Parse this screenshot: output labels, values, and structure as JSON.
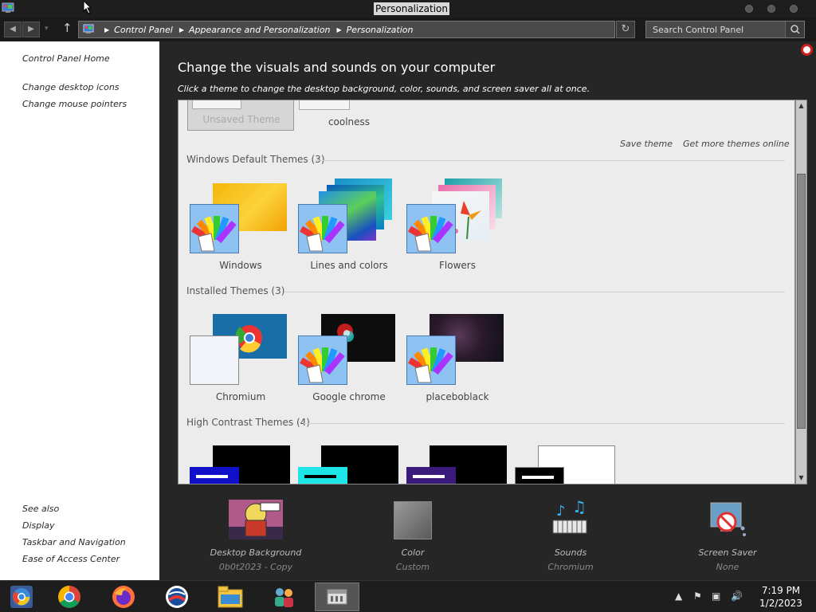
{
  "window": {
    "title": "Personalization"
  },
  "nav": {
    "breadcrumbs": [
      "Control Panel",
      "Appearance and Personalization",
      "Personalization"
    ],
    "search_placeholder": "Search Control Panel"
  },
  "sidebar": {
    "home": "Control Panel Home",
    "links": [
      "Change desktop icons",
      "Change mouse pointers"
    ],
    "see_also_title": "See also",
    "see_also": [
      "Display",
      "Taskbar and Navigation",
      "Ease of Access Center"
    ]
  },
  "main": {
    "heading": "Change the visuals and sounds on your computer",
    "subheading": "Click a theme to change the desktop background, color, sounds, and screen saver all at once.",
    "my_themes": [
      "Unsaved Theme",
      "coolness"
    ],
    "actions": {
      "save": "Save theme",
      "more": "Get more themes online"
    },
    "sections": {
      "default": {
        "title": "Windows Default Themes (3)",
        "themes": [
          "Windows",
          "Lines and colors",
          "Flowers"
        ]
      },
      "installed": {
        "title": "Installed Themes (3)",
        "themes": [
          "Chromium",
          "Google chrome",
          "placeboblack"
        ]
      },
      "contrast": {
        "title": "High Contrast Themes (4)"
      }
    }
  },
  "options": [
    {
      "label": "Desktop Background",
      "value": "0b0t2023 - Copy",
      "icon": "desktop-background-icon"
    },
    {
      "label": "Color",
      "value": "Custom",
      "icon": "color-swatch-icon"
    },
    {
      "label": "Sounds",
      "value": "Chromium",
      "icon": "sounds-icon"
    },
    {
      "label": "Screen Saver",
      "value": "None",
      "icon": "screen-saver-icon"
    }
  ],
  "taskbar": {
    "apps": [
      "chromium-icon",
      "chrome-icon",
      "firefox-icon",
      "obs-icon",
      "file-explorer-icon",
      "people-icon",
      "control-panel-icon"
    ],
    "clock": {
      "time": "7:19 PM",
      "date": "1/2/2023"
    }
  },
  "colors": {
    "accent": "#8ec2f2",
    "window_bg": "#262626",
    "sidebar_bg": "#ffffff"
  }
}
